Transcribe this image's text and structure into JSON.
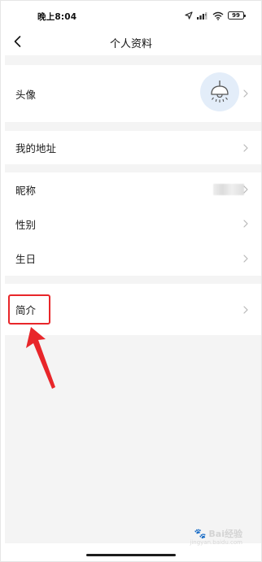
{
  "status_bar": {
    "time": "晚上8:04",
    "battery": "99"
  },
  "nav": {
    "title": "个人资料"
  },
  "sections": {
    "avatar_row": {
      "label": "头像"
    },
    "address_row": {
      "label": "我的地址"
    },
    "nickname_row": {
      "label": "昵称"
    },
    "gender_row": {
      "label": "性别"
    },
    "birthday_row": {
      "label": "生日"
    },
    "intro_row": {
      "label": "简介"
    }
  },
  "watermark": {
    "brand": "Bai经验",
    "url": "jingyan.baidu.com"
  },
  "colors": {
    "annotation": "#e8262a",
    "avatar_bg": "#e3edf9",
    "separator": "#f4f4f4"
  }
}
